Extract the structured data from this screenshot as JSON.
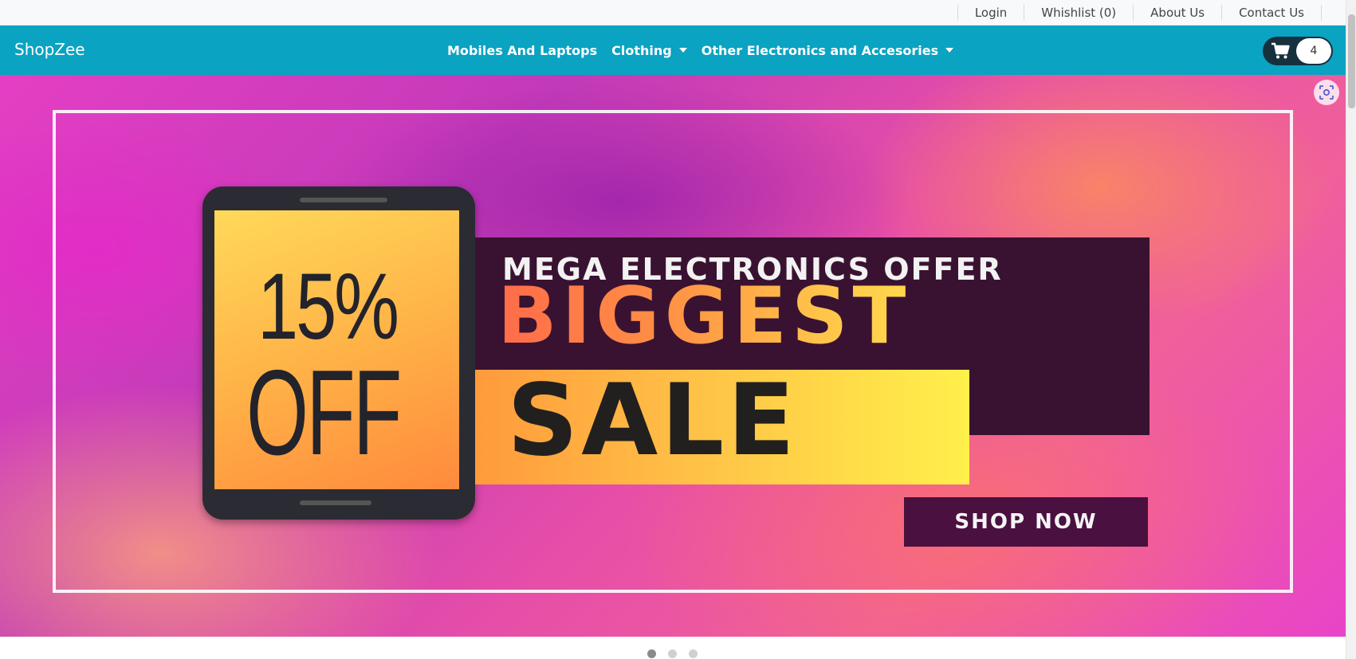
{
  "topbar": {
    "links": [
      "Login",
      "Whishlist (0)",
      "About Us",
      "Contact Us"
    ]
  },
  "navbar": {
    "brand": "ShopZee",
    "items": [
      {
        "label": "Mobiles And Laptops",
        "dropdown": false
      },
      {
        "label": "Clothing",
        "dropdown": true
      },
      {
        "label": "Other Electronics and Accesories",
        "dropdown": true
      }
    ],
    "cart_count": "4"
  },
  "banner": {
    "percent": "15%",
    "off": "OFF",
    "headline": "MEGA ELECTRONICS OFFER",
    "biggest": "BIGGEST",
    "sale": "SALE",
    "cta": "SHOP NOW"
  },
  "carousel": {
    "slide_count": 3,
    "active_index": 0
  },
  "colors": {
    "navbar": "#0aa3c2",
    "topbar": "#f8f9fa",
    "cart_pill": "#17303e"
  },
  "icons": {
    "cart": "shopping-cart-icon",
    "screenshot": "screenshot-capture-icon",
    "dropdown": "caret-down-icon"
  }
}
